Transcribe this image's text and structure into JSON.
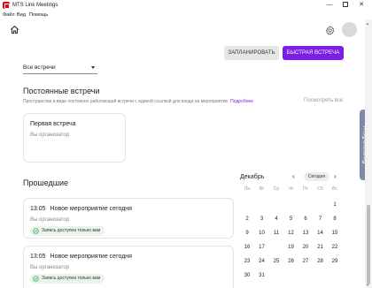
{
  "window": {
    "title": "MTS Link Meetings",
    "minimize": "—",
    "close": "✕"
  },
  "menu": [
    "Файл",
    "Вид",
    "Помощь"
  ],
  "header": {
    "schedule_label": "ЗАПЛАНИРОВАТЬ",
    "quick_label": "БЫСТРАЯ ВСТРЕЧА"
  },
  "filter": {
    "selected": "Все встречи"
  },
  "permanent": {
    "title": "Постоянные встречи",
    "description": "Пространства в виде постоянно работающей встречи с единой ссылкой для входа на мероприятие.",
    "link": "Подробнее",
    "see_all": "Посмотреть все",
    "card": {
      "title": "Первая встреча",
      "organizer": "Вы организатор"
    }
  },
  "past": {
    "title": "Прошедшие",
    "meetings": [
      {
        "time": "13:05",
        "title": "Новое мероприятие сегодня",
        "organizer": "Вы организатор",
        "badge": "Запись доступна только вам"
      },
      {
        "time": "13:05",
        "title": "Новое мероприятие сегодня",
        "organizer": "Вы организатор",
        "badge": "Запись доступна только вам"
      }
    ]
  },
  "calendar": {
    "month": "Декабрь",
    "prev": "‹",
    "next": "›",
    "today_label": "Сегодня",
    "weekdays": [
      "Пн",
      "Вт",
      "Ср",
      "Чт",
      "Пт",
      "Сб",
      "Вс"
    ],
    "weeks": [
      [
        "",
        "",
        "",
        "",
        "",
        "",
        "1"
      ],
      [
        "2",
        "3",
        "4",
        "5",
        "6",
        "7",
        "8"
      ],
      [
        "9",
        "10",
        "11",
        "12",
        "13",
        "14",
        "15"
      ],
      [
        "16",
        "17",
        "18",
        "19",
        "20",
        "21",
        "22"
      ],
      [
        "23",
        "24",
        "25",
        "26",
        "27",
        "28",
        "29"
      ],
      [
        "30",
        "31",
        "",
        "",
        "",
        "",
        ""
      ]
    ],
    "selected": "18",
    "accent": "#7b1fe6"
  },
  "side_tab": {
    "label": "MsgCatalog"
  }
}
